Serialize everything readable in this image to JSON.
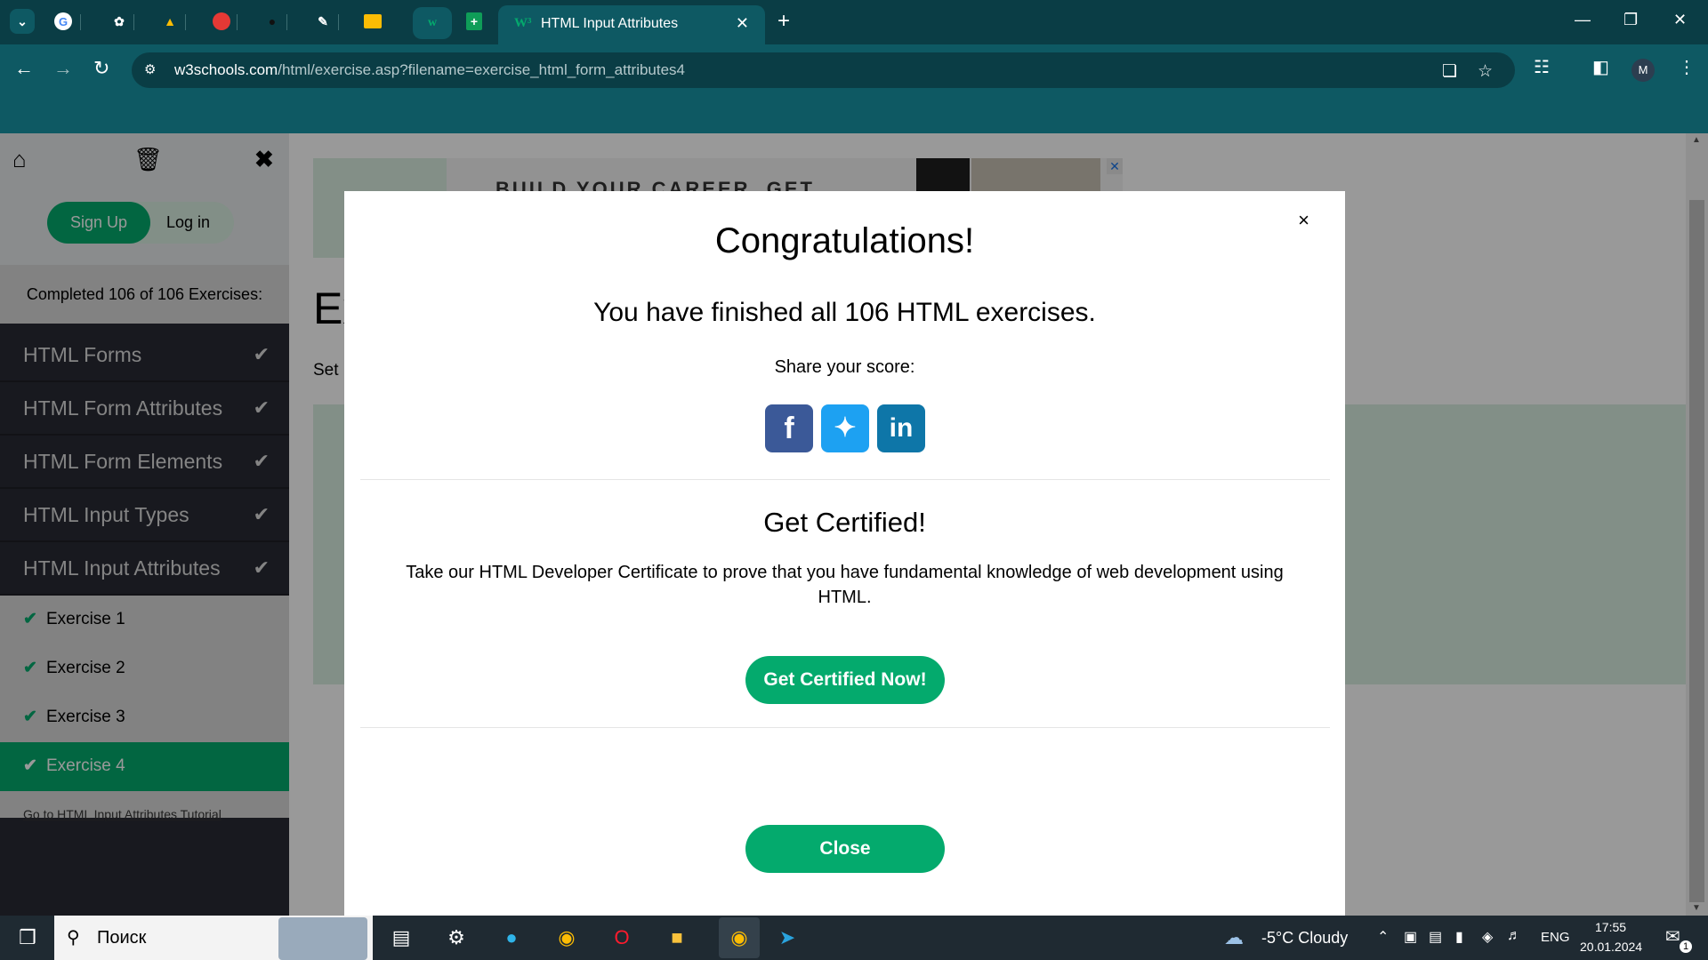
{
  "browser": {
    "active_tab_title": "HTML Input Attributes",
    "url_host": "w3schools.com",
    "url_path": "/html/exercise.asp?filename=exercise_html_form_attributes4"
  },
  "sidebar": {
    "signup_label": "Sign Up",
    "login_label": "Log in",
    "completed_text": "Completed 106 of 106 Exercises:",
    "chapters": [
      {
        "label": "HTML Forms"
      },
      {
        "label": "HTML Form Attributes"
      },
      {
        "label": "HTML Form Elements"
      },
      {
        "label": "HTML Input Types"
      },
      {
        "label": "HTML Input Attributes"
      }
    ],
    "exercises": [
      {
        "label": "Exercise 1"
      },
      {
        "label": "Exercise 2"
      },
      {
        "label": "Exercise 3"
      },
      {
        "label": "Exercise 4"
      }
    ],
    "tutorial_link": "Go to HTML Input Attributes Tutorial"
  },
  "page": {
    "ad_headline": "BUILD YOUR CAREER. GET",
    "title_partial": "Ex",
    "text_partial": "Set"
  },
  "modal": {
    "title": "Congratulations!",
    "finished_text": "You have finished all 106 HTML exercises.",
    "share_text": "Share your score:",
    "cert_title": "Get Certified!",
    "cert_text": "Take our HTML Developer Certificate to prove that you have fundamental knowledge of web development using HTML.",
    "cert_button": "Get Certified Now!",
    "close_button": "Close",
    "accent_color": "#04aa6d"
  },
  "taskbar": {
    "search_placeholder": "Поиск",
    "weather": "-5°C  Cloudy",
    "language": "ENG",
    "time": "17:55",
    "date": "20.01.2024",
    "notifications_count": "1"
  }
}
